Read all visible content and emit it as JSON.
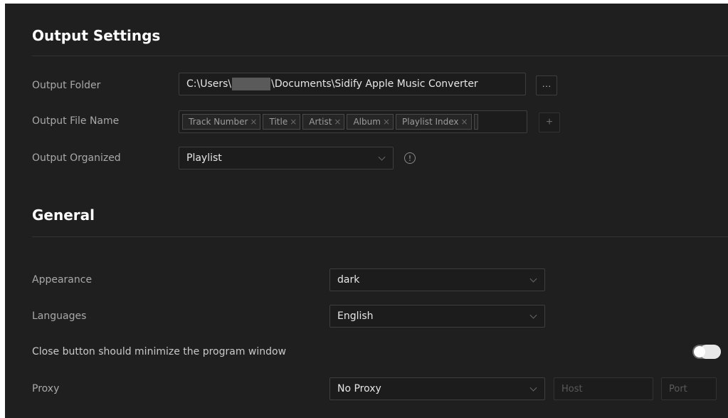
{
  "output_settings": {
    "title": "Output Settings",
    "output_folder": {
      "label": "Output Folder",
      "path_prefix": "C:\\Users\\",
      "path_suffix": "\\Documents\\Sidify Apple Music Converter",
      "browse_label": "···"
    },
    "output_file_name": {
      "label": "Output File Name",
      "tags": [
        "Track Number",
        "Title",
        "Artist",
        "Album",
        "Playlist Index"
      ],
      "tag_remove": "×",
      "add_label": "+"
    },
    "output_organized": {
      "label": "Output Organized",
      "value": "Playlist",
      "info": "!"
    }
  },
  "general": {
    "title": "General",
    "appearance": {
      "label": "Appearance",
      "value": "dark"
    },
    "languages": {
      "label": "Languages",
      "value": "English"
    },
    "close_minimize": {
      "label": "Close button should minimize the program window",
      "enabled": true
    },
    "proxy": {
      "label": "Proxy",
      "value": "No Proxy",
      "host_placeholder": "Host",
      "port_placeholder": "Port"
    }
  },
  "colors": {
    "background": "#1f1f1f",
    "text": "#e6e6e6",
    "label": "#a9a9a9",
    "border": "#3e3e3e"
  }
}
